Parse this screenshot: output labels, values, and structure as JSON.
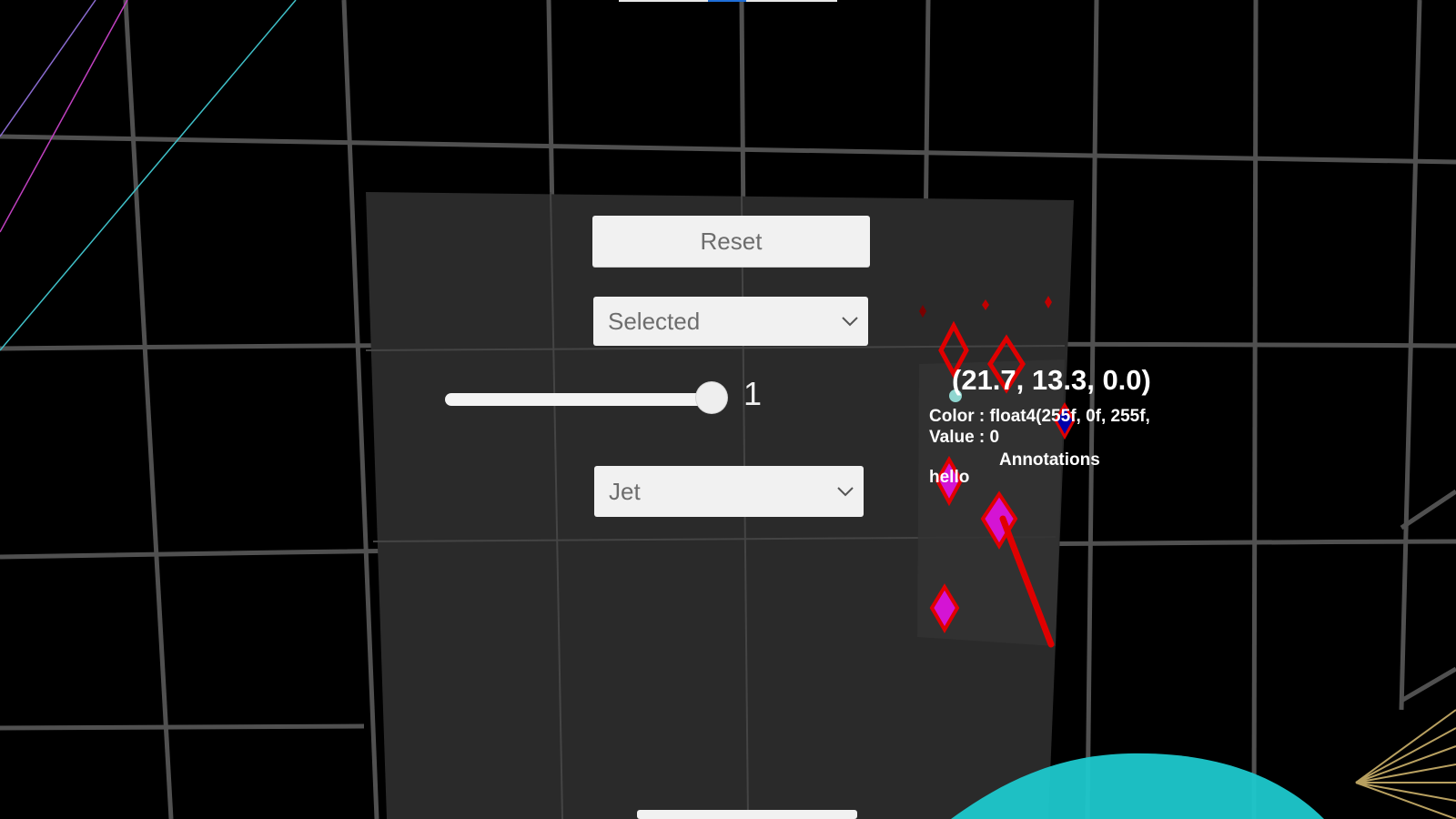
{
  "menu": {
    "reset_label": "Reset",
    "selection_dropdown": {
      "selected": "Selected"
    },
    "slider": {
      "value": "1",
      "level": 1.0
    },
    "colormap_dropdown": {
      "selected": "Jet"
    }
  },
  "tooltip": {
    "coordinates": "(21.7, 13.3, 0.0)",
    "color": "Color : float4(255f, 0f, 255f,",
    "value": "Value : 0"
  },
  "annotations": {
    "title": "Annotations",
    "items": [
      "hello"
    ]
  },
  "colors": {
    "background": "#000000",
    "panel": "#2a2a2a",
    "button": "#f1f1f1",
    "marker_fill": "#d414d4",
    "marker_outline": "#e00000",
    "pointer_ray": "#e00000",
    "surface": "#1ec8cc",
    "grid": "#6a6a6a"
  },
  "icons": {
    "dropdown_arrow": "chevron-down-icon",
    "cursor": "cursor-dot-icon"
  }
}
